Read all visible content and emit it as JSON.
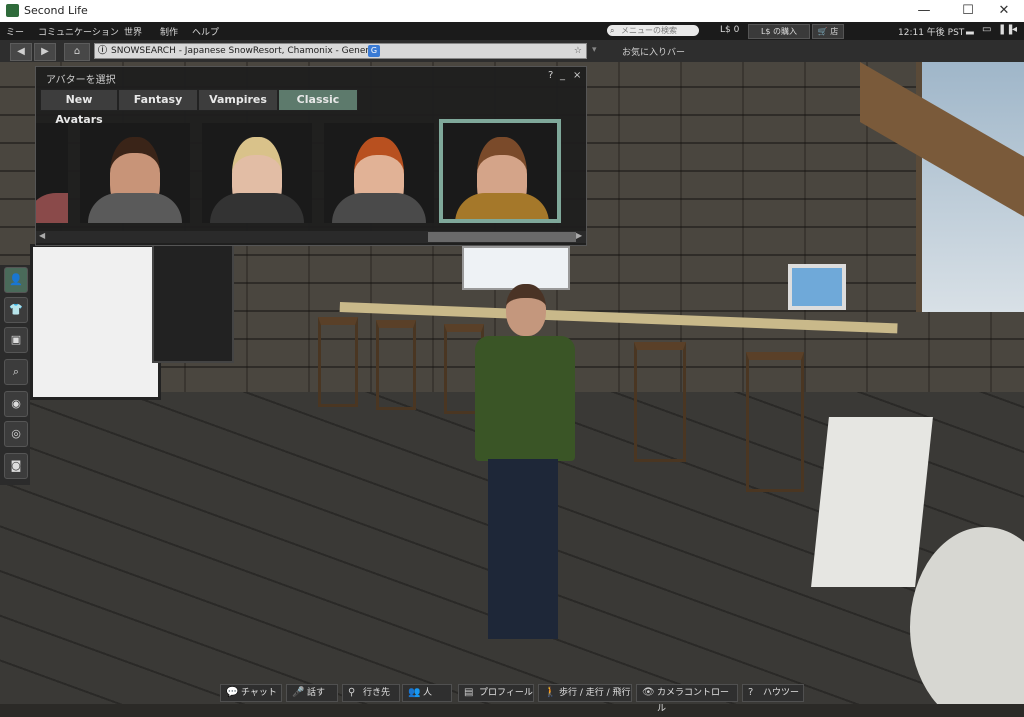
{
  "window": {
    "title": "Second Life",
    "minimize": "—",
    "maximize": "☐",
    "close": "✕"
  },
  "menu": {
    "items": [
      "ミー",
      "コミュニケーション",
      "世界",
      "制作",
      "ヘルプ"
    ],
    "search_placeholder": "メニューの検索",
    "balance": "L$ 0",
    "buy_label": "L$ の購入",
    "shop_label": "店",
    "clock": "12:11 午後 PST"
  },
  "nav": {
    "url": "SNOWSEARCH - Japanese SnowResort, Chamonix - General",
    "maturity_badge": "G",
    "favorites_label": "お気に入りバー"
  },
  "picker": {
    "title": "アバターを選択",
    "help": "?",
    "minimize": "_",
    "close": "×",
    "tabs": [
      "New Avatars",
      "Fantasy",
      "Vampires",
      "Classic"
    ],
    "active_tab": 3,
    "selected_thumb": 3
  },
  "bottombar": {
    "buttons": [
      {
        "label": "チャット",
        "icon": "chat-icon"
      },
      {
        "label": "話す",
        "icon": "microphone-icon"
      },
      {
        "label": "行き先",
        "icon": "map-pin-icon"
      },
      {
        "label": "人",
        "icon": "people-icon"
      },
      {
        "label": "プロフィール",
        "icon": "profile-icon"
      },
      {
        "label": "歩行 / 走行 / 飛行",
        "icon": "walk-icon"
      },
      {
        "label": "カメラコントロール",
        "icon": "eye-icon"
      },
      {
        "label": "ハウツー",
        "icon": "help-icon"
      }
    ]
  },
  "sidebar": {
    "icons": [
      "people-icon",
      "shirt-icon",
      "inventory-icon",
      "search-icon",
      "places-icon",
      "radar-icon",
      "camera-icon"
    ]
  }
}
